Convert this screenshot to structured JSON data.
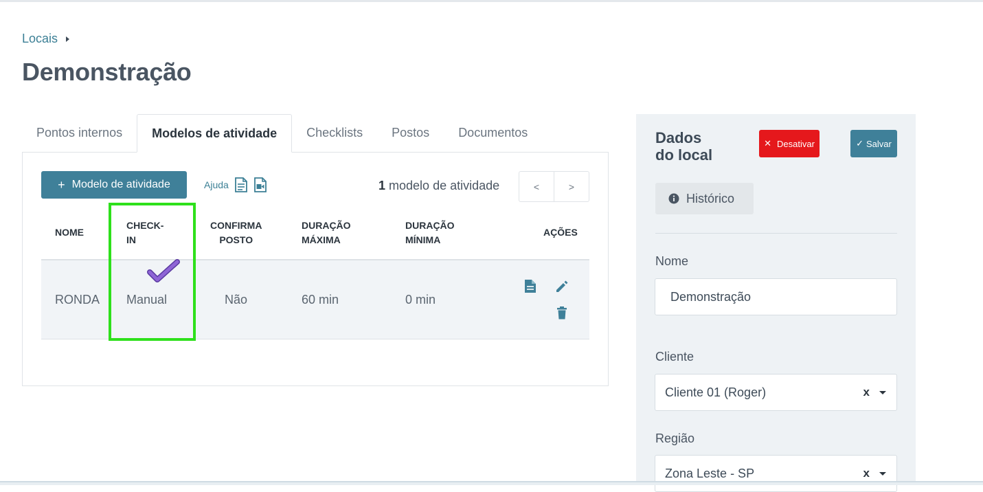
{
  "breadcrumb": {
    "parent": "Locais"
  },
  "page": {
    "title": "Demonstração"
  },
  "tabs": [
    {
      "label": "Pontos internos",
      "active": false
    },
    {
      "label": "Modelos de atividade",
      "active": true
    },
    {
      "label": "Checklists",
      "active": false
    },
    {
      "label": "Postos",
      "active": false
    },
    {
      "label": "Documentos",
      "active": false
    }
  ],
  "toolbar": {
    "add_label": "Modelo de atividade",
    "help_label": "Ajuda",
    "count_number": "1",
    "count_text": "modelo de atividade",
    "prev": "<",
    "next": ">"
  },
  "table": {
    "headers": {
      "nome": "NOME",
      "checkin_1": "CHECK-",
      "checkin_2": "IN",
      "confirma_1": "CONFIRMA",
      "confirma_2": "POSTO",
      "dmax_1": "DURAÇÃO",
      "dmax_2": "MÁXIMA",
      "dmin_1": "DURAÇÃO",
      "dmin_2": "MÍNIMA",
      "acoes": "AÇÕES"
    },
    "rows": [
      {
        "nome": "RONDA",
        "checkin": "Manual",
        "confirma_posto": "Não",
        "duracao_maxima": "60 min",
        "duracao_minima": "0 min"
      }
    ]
  },
  "sidebar": {
    "title_1": "Dados",
    "title_2": "do local",
    "deactivate_label": "Desativar",
    "save_label": "Salvar",
    "history_label": "Histórico",
    "nome_label": "Nome",
    "nome_value": "Demonstração",
    "cliente_label": "Cliente",
    "cliente_value": "Cliente 01 (Roger)",
    "regiao_label": "Região",
    "regiao_value": "Zona Leste - SP",
    "clear_symbol": "x"
  },
  "colors": {
    "primary": "#3f8099",
    "danger": "#e5181c",
    "highlight": "#2ee01b",
    "checkmark": "#8155c9"
  }
}
